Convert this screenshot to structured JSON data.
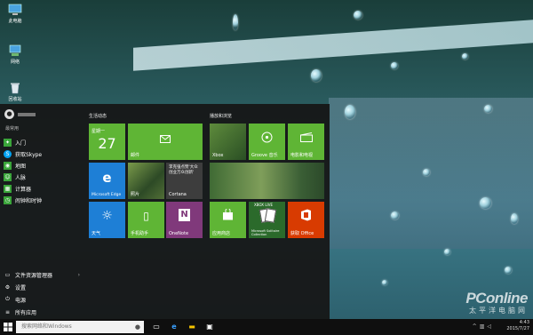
{
  "desktop": {
    "icons": [
      {
        "label": "此电脑",
        "icon": "computer-icon"
      },
      {
        "label": "网络",
        "icon": "network-icon"
      },
      {
        "label": "回收站",
        "icon": "recycle-bin-icon"
      }
    ],
    "watermark": {
      "brand": "PConline",
      "sub": "太平洋电脑网"
    }
  },
  "start_menu": {
    "user": {
      "avatar_glyph": "●"
    },
    "most_used_label": "最常用",
    "apps": [
      {
        "label": "入门",
        "icon": "lightbulb-icon",
        "color": "#3aa53a"
      },
      {
        "label": "获取Skype",
        "icon": "skype-icon",
        "color": "#00a1f1"
      },
      {
        "label": "地图",
        "icon": "map-icon",
        "color": "#3aa53a"
      },
      {
        "label": "人脉",
        "icon": "people-icon",
        "color": "#3aa53a"
      },
      {
        "label": "计算器",
        "icon": "calculator-icon",
        "color": "#3aa53a"
      },
      {
        "label": "闹钟和时钟",
        "icon": "alarm-icon",
        "color": "#3aa53a"
      }
    ],
    "bottom": [
      {
        "label": "文件资源管理器",
        "icon": "folder-icon",
        "chevron": "›"
      },
      {
        "label": "设置",
        "icon": "gear-icon"
      },
      {
        "label": "电源",
        "icon": "power-icon"
      },
      {
        "label": "所有应用",
        "icon": "all-apps-icon"
      }
    ],
    "groups": [
      {
        "label": "生活动态"
      },
      {
        "label": "播放和浏览"
      }
    ],
    "tiles": {
      "calendar": {
        "day": "星期一",
        "date": "27"
      },
      "mail": {
        "label": "邮件"
      },
      "edge": {
        "label": "Microsoft Edge"
      },
      "photos": {
        "label": "照片"
      },
      "cortana": {
        "label": "Cortana",
        "text": "李克强点赞'大众创业万众创新'"
      },
      "weather": {
        "label": "天气"
      },
      "phone": {
        "label": "手机助手"
      },
      "onenote": {
        "label": "OneNote"
      },
      "xbox": {
        "label": "Xbox"
      },
      "groove": {
        "label": "Groove 音乐"
      },
      "movies": {
        "label": "电影和电视"
      },
      "news": {
        "label": ""
      },
      "store": {
        "label": "应用商店"
      },
      "solitaire": {
        "label": "Microsoft Solitaire Collection",
        "badge": "XBOX LIVE"
      },
      "getoffice": {
        "label": "获取 Office"
      }
    }
  },
  "taskbar": {
    "search_placeholder": "搜索网络和Windows",
    "time": "4:43",
    "date": "2015/7/27",
    "colors": {
      "accent": "#8cc63f"
    }
  }
}
